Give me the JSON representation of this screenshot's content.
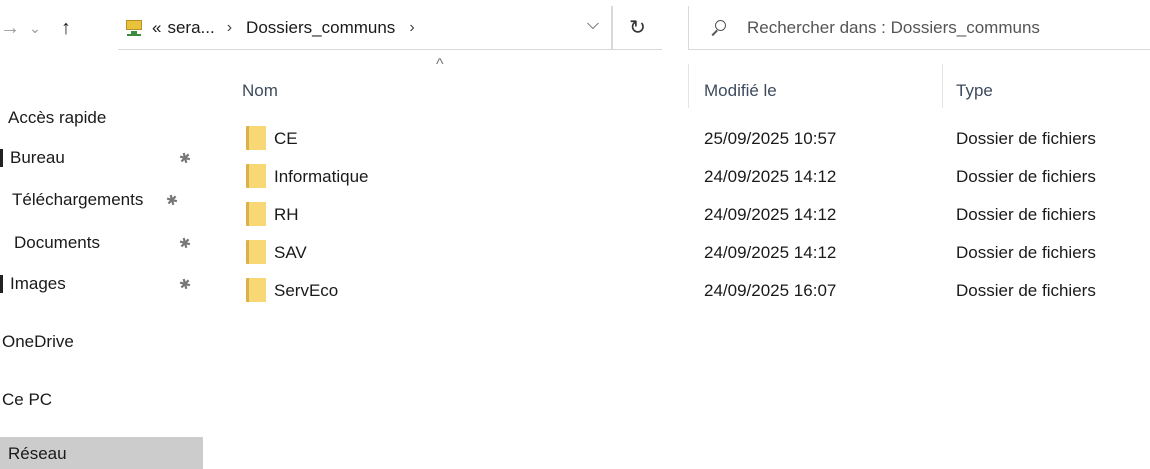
{
  "address": {
    "breadcrumb_prefix": "«",
    "crumbs": [
      "sera...",
      "Dossiers_communs"
    ],
    "separator": "›",
    "dropdown": "⌵"
  },
  "nav": {
    "back": "→",
    "history": "⌄",
    "up": "↑",
    "refresh": "↻"
  },
  "search": {
    "placeholder": "Rechercher dans : Dossiers_communs"
  },
  "sidebar": {
    "items": [
      {
        "label": "Accès rapide",
        "pinned": false
      },
      {
        "label": "Bureau",
        "pinned": true
      },
      {
        "label": "Téléchargements",
        "pinned": true
      },
      {
        "label": "Documents",
        "pinned": true
      },
      {
        "label": "Images",
        "pinned": true
      },
      {
        "label": "OneDrive",
        "pinned": false
      },
      {
        "label": "Ce PC",
        "pinned": false
      },
      {
        "label": "Réseau",
        "pinned": false,
        "selected": true
      }
    ],
    "pin_glyph": "📌"
  },
  "columns": {
    "name": "Nom",
    "modified": "Modifié le",
    "type": "Type",
    "sort_glyph": "^"
  },
  "files": [
    {
      "name": "CE",
      "modified": "25/09/2025 10:57",
      "type": "Dossier de fichiers"
    },
    {
      "name": "Informatique",
      "modified": "24/09/2025 14:12",
      "type": "Dossier de fichiers"
    },
    {
      "name": "RH",
      "modified": "24/09/2025 14:12",
      "type": "Dossier de fichiers"
    },
    {
      "name": "SAV",
      "modified": "24/09/2025 14:12",
      "type": "Dossier de fichiers"
    },
    {
      "name": "ServEco",
      "modified": "24/09/2025 16:07",
      "type": "Dossier de fichiers"
    }
  ],
  "colors": {
    "selected_bg": "#cccccc",
    "folder": "#f8d775",
    "header_text": "#3c4b5e"
  }
}
